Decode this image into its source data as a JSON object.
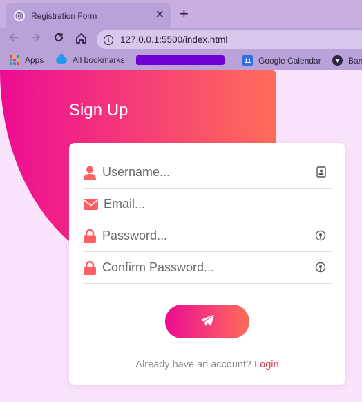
{
  "browser": {
    "tab_title": "Registration Form",
    "tab_close": "✕",
    "new_tab": "+",
    "url": "127.0.0.1:5500/index.html",
    "bookmarks": {
      "apps": "Apps",
      "all_bookmarks": "All bookmarks",
      "google_calendar": "Google Calendar",
      "calendar_day": "11",
      "bank_partial": "Ban"
    }
  },
  "page": {
    "heading": "Sign Up",
    "fields": {
      "username_placeholder": "Username...",
      "email_placeholder": "Email...",
      "password_placeholder": "Password...",
      "confirm_placeholder": "Confirm Password..."
    },
    "footer_text": "Already have an account?",
    "login_link": "Login"
  },
  "colors": {
    "gradient_start": "#ec0c93",
    "gradient_end": "#ff6d5a",
    "icon": "#ff5e62",
    "background": "#fae3fb"
  }
}
